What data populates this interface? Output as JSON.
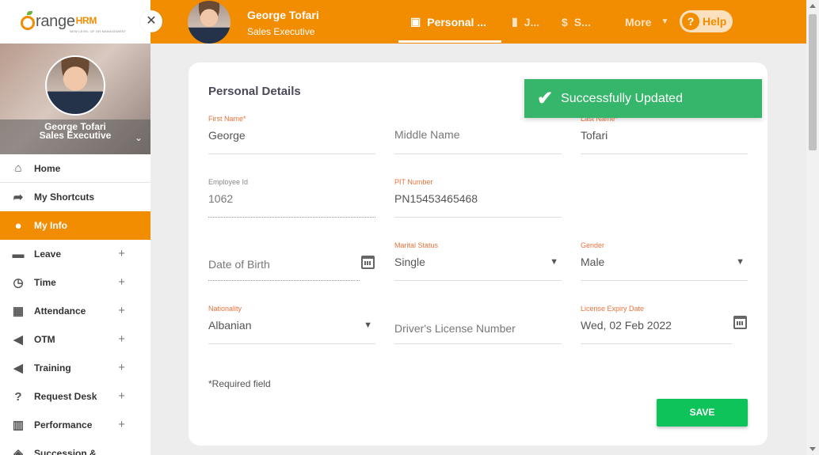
{
  "app": {
    "logo_text": "range",
    "logo_suffix": "HRM",
    "logo_tagline": "NEW LEVEL OF HR MANAGEMENT"
  },
  "sidebar": {
    "profile_name": "George Tofari",
    "profile_title": "Sales Executive",
    "close_glyph": "✕",
    "items": [
      {
        "label": "Home",
        "icon": "home-icon",
        "glyph": "⌂",
        "expand": ""
      },
      {
        "label": "My Shortcuts",
        "icon": "share-arrow-icon",
        "glyph": "➦",
        "expand": ""
      },
      {
        "label": "My Info",
        "icon": "user-circle-icon",
        "glyph": "●",
        "expand": ""
      },
      {
        "label": "Leave",
        "icon": "briefcase-icon",
        "glyph": "▬",
        "expand": "+"
      },
      {
        "label": "Time",
        "icon": "clock-icon",
        "glyph": "◷",
        "expand": "+"
      },
      {
        "label": "Attendance",
        "icon": "calendar-check-icon",
        "glyph": "▦",
        "expand": "+"
      },
      {
        "label": "OTM",
        "icon": "megaphone-icon",
        "glyph": "◀",
        "expand": "+"
      },
      {
        "label": "Training",
        "icon": "megaphone-icon",
        "glyph": "◀",
        "expand": "+"
      },
      {
        "label": "Request Desk",
        "icon": "question-box-icon",
        "glyph": "?",
        "expand": "+"
      },
      {
        "label": "Performance",
        "icon": "bar-chart-icon",
        "glyph": "▥",
        "expand": "+"
      },
      {
        "label": "Succession &",
        "icon": "succession-icon",
        "glyph": "◈",
        "expand": ""
      }
    ]
  },
  "topbar": {
    "user_name": "George Tofari",
    "user_title": "Sales Executive",
    "tabs": [
      {
        "label": "Personal ...",
        "icon": "id-card-icon",
        "glyph": "▣"
      },
      {
        "label": "J...",
        "icon": "tie-icon",
        "glyph": "▮"
      },
      {
        "label": "S...",
        "icon": "dollar-icon",
        "glyph": "$"
      },
      {
        "label": "More",
        "icon": "caret-down-icon",
        "glyph": "▼"
      }
    ],
    "help_label": "Help",
    "help_glyph": "?"
  },
  "toast": {
    "message": "Successfully Updated",
    "glyph": "✔",
    "color": "#35b66b"
  },
  "form": {
    "title": "Personal Details",
    "first_name": {
      "label": "First Name*",
      "value": "George"
    },
    "middle_name": {
      "placeholder": "Middle Name"
    },
    "last_name": {
      "label": "Last Name*",
      "value": "Tofari"
    },
    "employee_id": {
      "label": "Employee Id",
      "value": "1062"
    },
    "pit_number": {
      "label": "PIT Number",
      "value": "PN15453465468"
    },
    "date_of_birth": {
      "placeholder": "Date of Birth"
    },
    "marital_status": {
      "label": "Marital Status",
      "value": "Single"
    },
    "gender": {
      "label": "Gender",
      "value": "Male"
    },
    "nationality": {
      "label": "Nationality",
      "value": "Albanian"
    },
    "drivers_license": {
      "placeholder": "Driver's License Number"
    },
    "license_expiry": {
      "label": "License Expiry Date",
      "value": "Wed, 02 Feb 2022"
    },
    "required_note": "*Required field",
    "save_label": "SAVE"
  },
  "colors": {
    "brand_orange": "#f28c00",
    "label_orange": "#e8733d",
    "save_green": "#0ec45a"
  }
}
